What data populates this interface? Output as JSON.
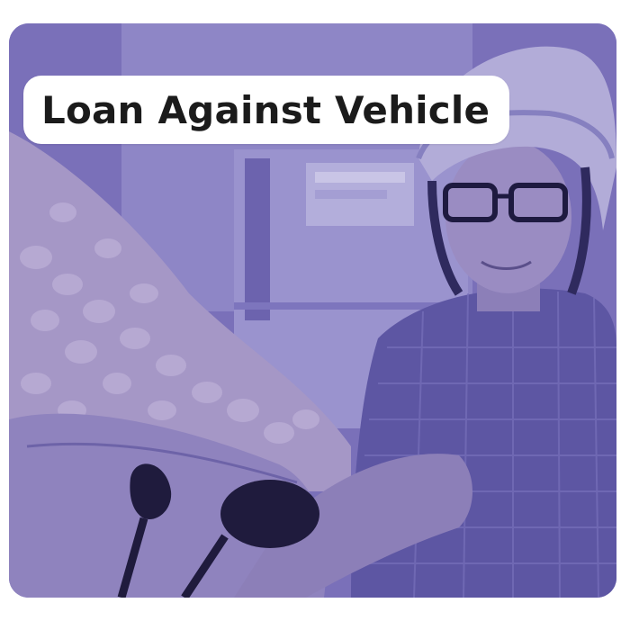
{
  "card": {
    "title": "Loan Against Vehicle",
    "tint_color": "#5b4fb3",
    "image_subject": "man-with-helmet-on-scooter"
  }
}
